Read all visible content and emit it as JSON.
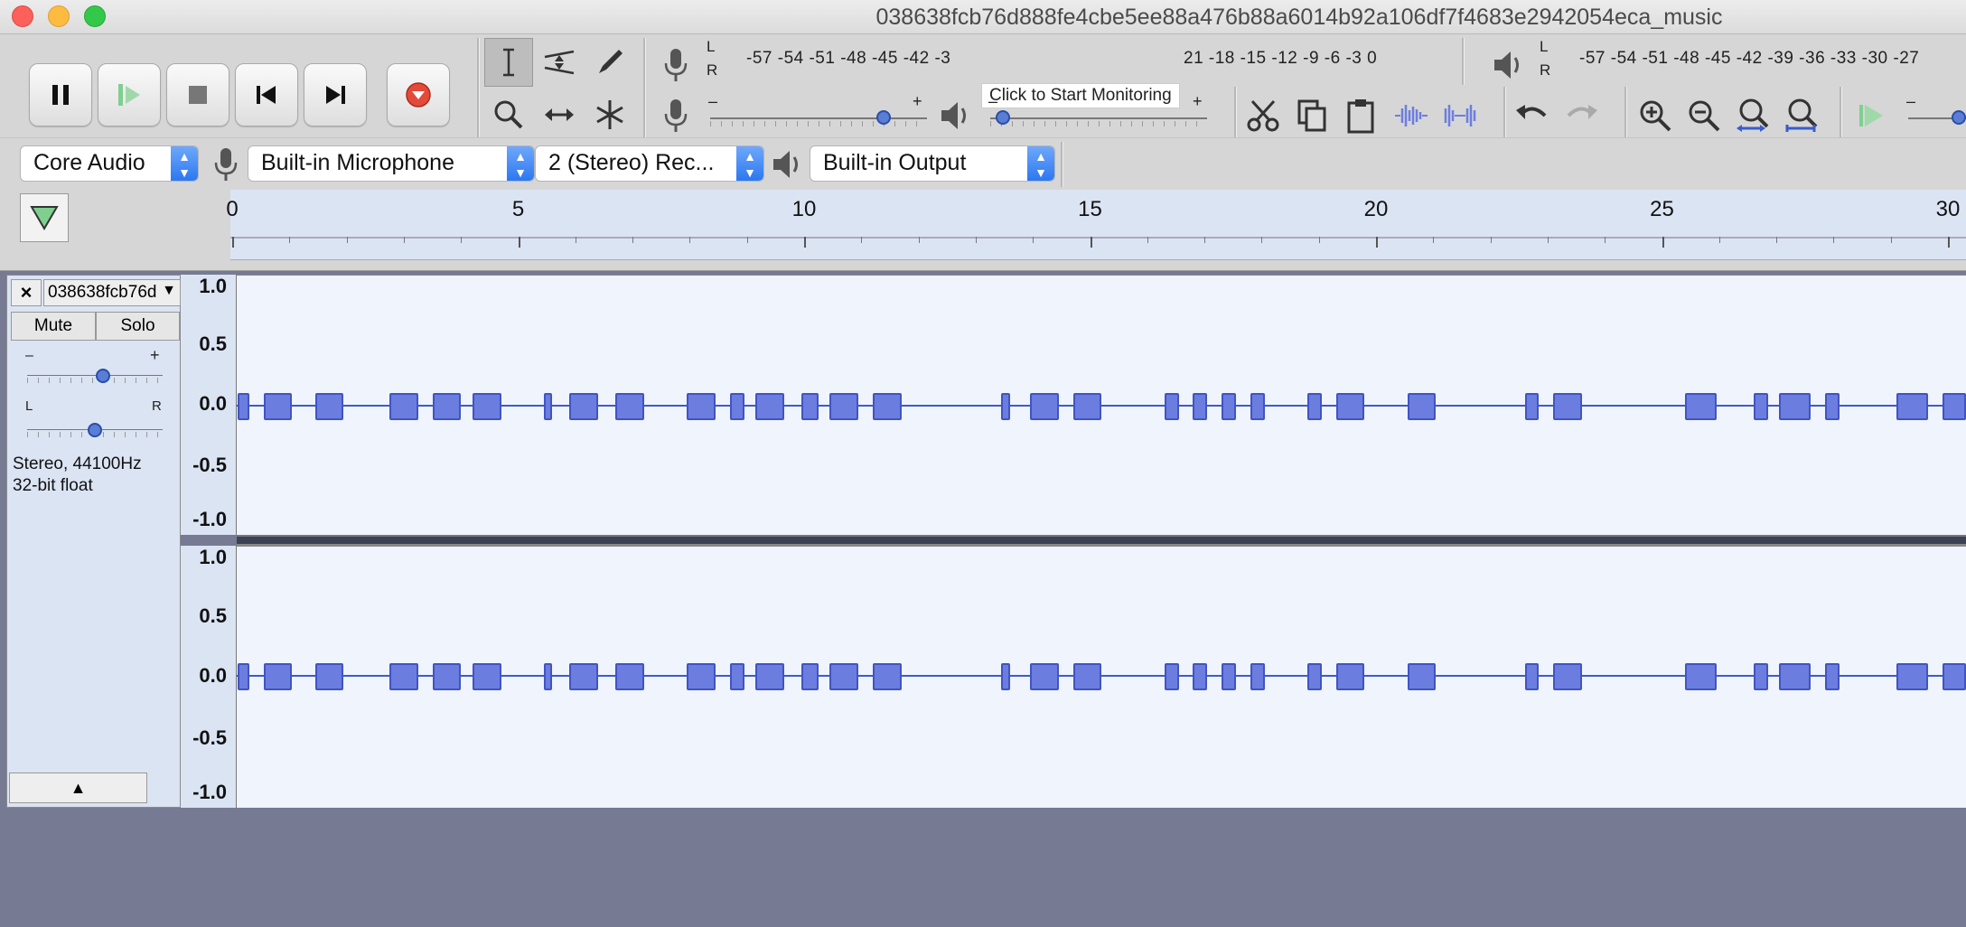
{
  "window": {
    "title": "038638fcb76d888fe4cbe5ee88a476b88a6014b92a106df7f4683e2942054eca_music"
  },
  "meters": {
    "record": {
      "L": "L",
      "R": "R",
      "scale": "-57 -54 -51 -48 -45 -42 -3",
      "scale_right": "21 -18 -15 -12 -9 -6 -3 0"
    },
    "monitor_tooltip": "Click to Start Monitoring",
    "playback": {
      "L": "L",
      "R": "R",
      "scale": "-57 -54 -51 -48 -45 -42 -39 -36 -33 -30 -27"
    },
    "minus": "–",
    "plus": "+"
  },
  "devices": {
    "host": "Core Audio",
    "input": "Built-in Microphone",
    "channels": "2 (Stereo) Rec...",
    "output": "Built-in Output"
  },
  "timeline": {
    "ticks": [
      "0",
      "5",
      "10",
      "15",
      "20",
      "25",
      "30"
    ]
  },
  "track": {
    "close": "×",
    "name": "038638fcb76d",
    "dropdown": "▼",
    "mute": "Mute",
    "solo": "Solo",
    "gain_minus": "–",
    "gain_plus": "+",
    "pan_left": "L",
    "pan_right": "R",
    "info_line1": "Stereo, 44100Hz",
    "info_line2": "32-bit float",
    "collapse": "▲",
    "gain_level": 0.56,
    "pan_level": 0.5
  },
  "vruler": {
    "labels": [
      "1.0",
      "0.5",
      "0.0",
      "-0.5",
      "-1.0"
    ]
  },
  "colors": {
    "waveform": "#6c7de0",
    "background": "#767a93",
    "track_bg": "#f0f4fc"
  },
  "clip_seconds": [
    [
      0.1,
      0.3
    ],
    [
      0.55,
      1.05
    ],
    [
      1.45,
      1.95
    ],
    [
      2.75,
      3.25
    ],
    [
      3.5,
      4.0
    ],
    [
      4.2,
      4.7
    ],
    [
      5.45,
      5.6
    ],
    [
      5.9,
      6.4
    ],
    [
      6.7,
      7.2
    ],
    [
      7.95,
      8.45
    ],
    [
      8.7,
      8.95
    ],
    [
      9.15,
      9.65
    ],
    [
      9.95,
      10.25
    ],
    [
      10.45,
      10.95
    ],
    [
      11.2,
      11.7
    ],
    [
      13.45,
      13.6
    ],
    [
      13.95,
      14.45
    ],
    [
      14.7,
      15.2
    ],
    [
      16.3,
      16.55
    ],
    [
      16.8,
      17.05
    ],
    [
      17.3,
      17.55
    ],
    [
      17.8,
      18.05
    ],
    [
      18.8,
      19.05
    ],
    [
      19.3,
      19.8
    ],
    [
      20.55,
      21.05
    ],
    [
      22.6,
      22.85
    ],
    [
      23.1,
      23.6
    ],
    [
      25.4,
      25.95
    ],
    [
      26.6,
      26.85
    ],
    [
      27.05,
      27.6
    ],
    [
      27.85,
      28.1
    ],
    [
      29.1,
      29.65
    ],
    [
      29.9,
      30.5
    ]
  ]
}
